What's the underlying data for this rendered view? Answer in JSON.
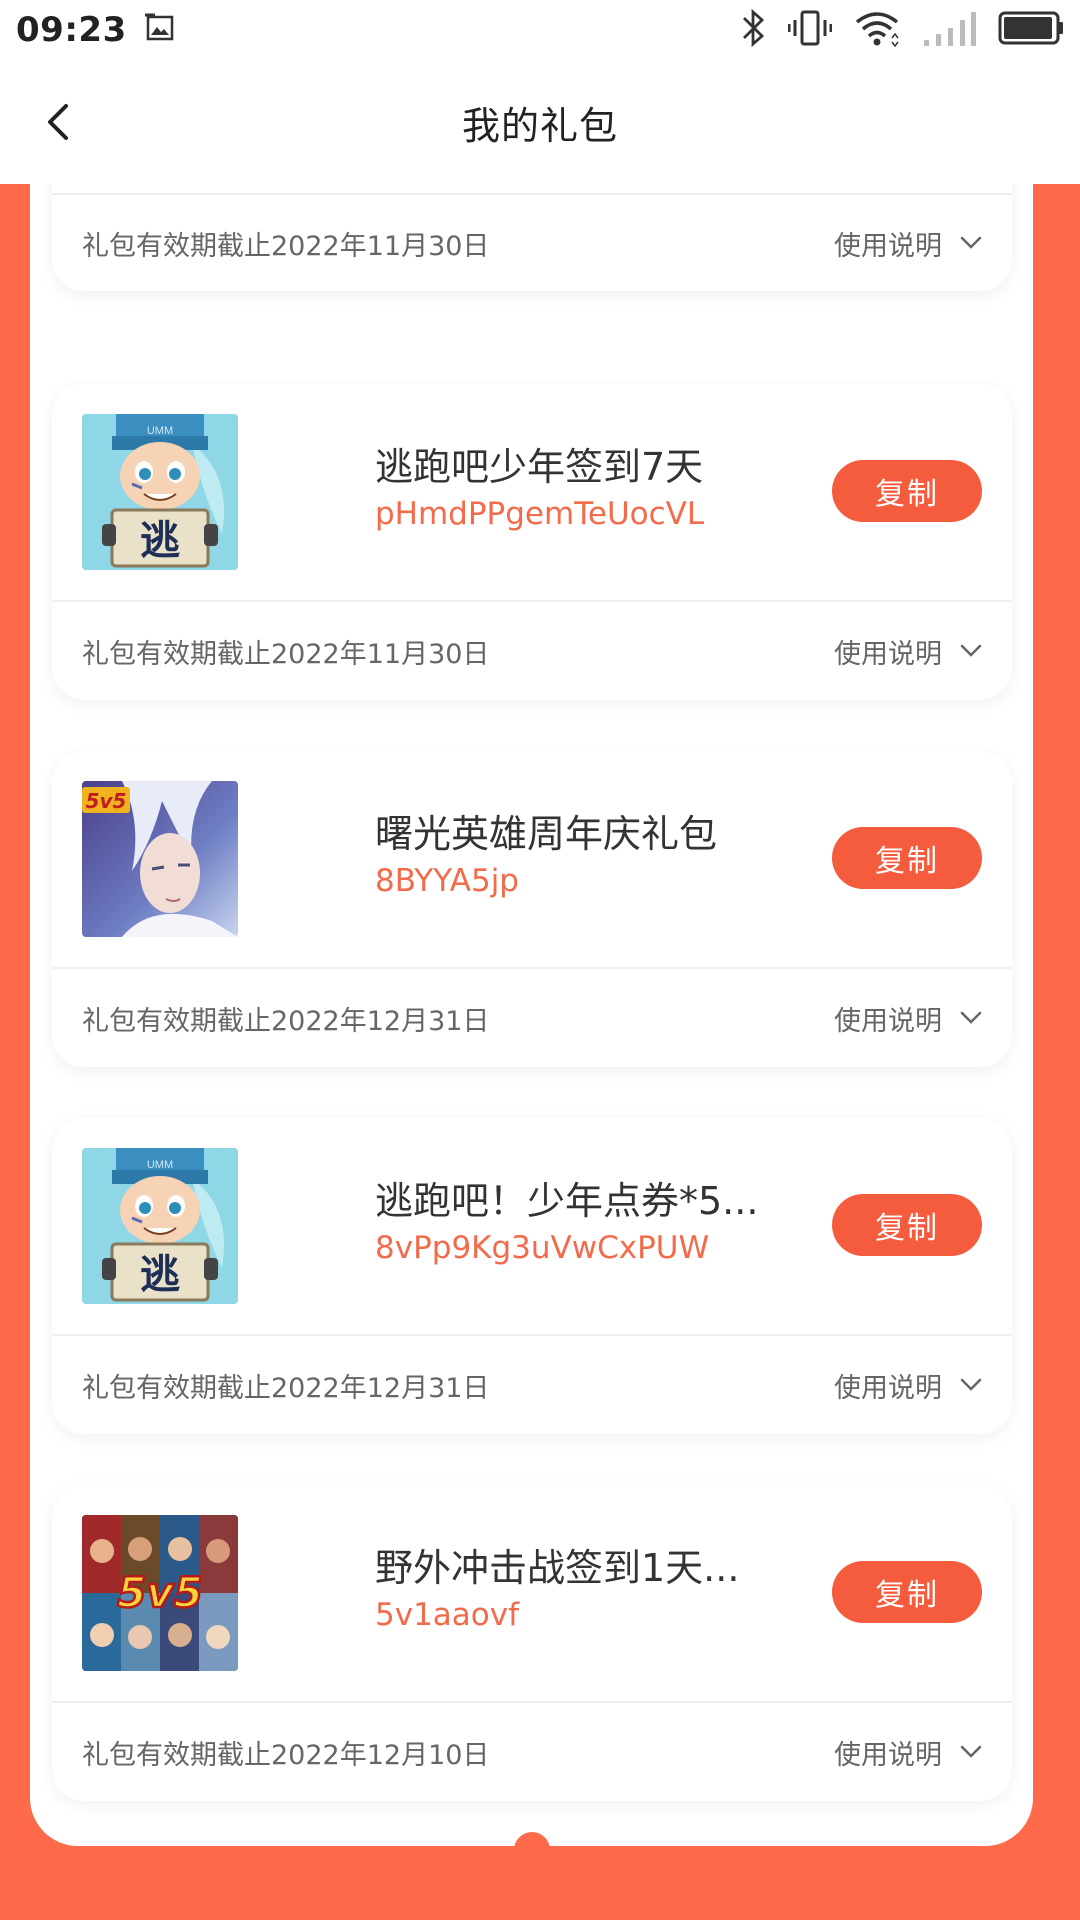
{
  "status_bar": {
    "time": "09:23"
  },
  "header": {
    "title": "我的礼包"
  },
  "colors": {
    "accent": "#f45c3d",
    "background_orange": "#ff6a4b",
    "code_text": "#f26b4b"
  },
  "partial_card": {
    "expiry": "礼包有效期截止2022年11月30日",
    "usage_label": "使用说明"
  },
  "cards": [
    {
      "name": "逃跑吧少年签到7天",
      "code": "pHmdPPgemTeUocVL",
      "copy_label": "复制",
      "expiry": "礼包有效期截止2022年11月30日",
      "usage_label": "使用说明",
      "icon": "escape-boy-game-icon"
    },
    {
      "name": "曙光英雄周年庆礼包",
      "code": "8BYYA5jp",
      "copy_label": "复制",
      "expiry": "礼包有效期截止2022年12月31日",
      "usage_label": "使用说明",
      "icon": "dawn-hero-game-icon"
    },
    {
      "name": "逃跑吧！少年点券*5...",
      "code": "8vPp9Kg3uVwCxPUW",
      "copy_label": "复制",
      "expiry": "礼包有效期截止2022年12月31日",
      "usage_label": "使用说明",
      "icon": "escape-boy-game-icon"
    },
    {
      "name": "野外冲击战签到1天...",
      "code": "5v1aaovf",
      "copy_label": "复制",
      "expiry": "礼包有效期截止2022年12月10日",
      "usage_label": "使用说明",
      "icon": "wild-battle-game-icon"
    }
  ]
}
